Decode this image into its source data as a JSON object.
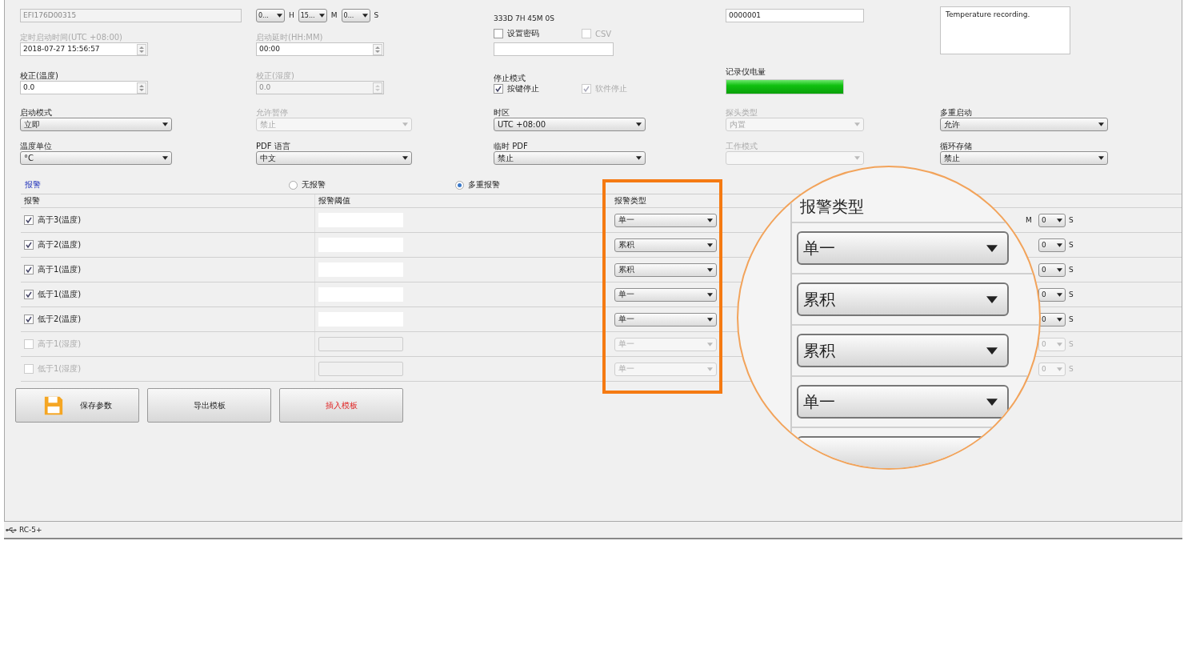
{
  "serial_field": {
    "value": "EFI176D00315"
  },
  "interval": [
    {
      "value": "0...",
      "unit": "H"
    },
    {
      "value": "15...",
      "unit": "M"
    },
    {
      "value": "0...",
      "unit": "S"
    }
  ],
  "duration": "333D 7H 45M 0S",
  "logger_number": {
    "value": "0000001"
  },
  "description": {
    "value": "Temperature recording."
  },
  "timed_start": {
    "label": "定时启动时间(UTC +08:00)",
    "value": "2018-07-27 15:56:57",
    "disabled": true
  },
  "start_delay": {
    "label": "启动延时(HH:MM)",
    "value": "00:00",
    "disabled": true
  },
  "options": [
    {
      "label": "设置密码",
      "checked": false,
      "disabled": false
    },
    {
      "label": "CSV",
      "checked": false,
      "disabled": true
    }
  ],
  "calibration": [
    {
      "label": "校正(温度)",
      "value": "0.0",
      "disabled": false
    },
    {
      "label": "校正(湿度)",
      "value": "0.0",
      "disabled": true
    }
  ],
  "stop_mode": {
    "label": "停止模式",
    "options": [
      {
        "label": "按键停止",
        "checked": true,
        "disabled": false
      },
      {
        "label": "软件停止",
        "checked": true,
        "disabled": true
      }
    ]
  },
  "battery": {
    "label": "记录仪电量",
    "level": 1.0
  },
  "select_rows": [
    [
      {
        "label": "启动模式",
        "value": "立即",
        "disabled": false
      },
      {
        "label": "允许暂停",
        "value": "禁止",
        "disabled": true
      },
      {
        "label": "时区",
        "value": "UTC +08:00",
        "disabled": false
      },
      {
        "label": "探头类型",
        "value": "内置",
        "disabled": true
      },
      {
        "label": "多重启动",
        "value": "允许",
        "disabled": false
      }
    ],
    [
      {
        "label": "温度单位",
        "value": "°C",
        "disabled": false
      },
      {
        "label": "PDF 语言",
        "value": "中文",
        "disabled": false
      },
      {
        "label": "临时 PDF",
        "value": "禁止",
        "disabled": false
      },
      {
        "label": "工作模式",
        "disabled": true
      },
      {
        "label": "循环存储",
        "value": "禁止",
        "disabled": false
      }
    ]
  ],
  "alarm": {
    "title": "报警",
    "modes": [
      {
        "label": "无报警",
        "selected": false
      },
      {
        "label": "多重报警",
        "selected": true
      }
    ],
    "columns": [
      "报警",
      "报警阈值",
      "报警类型"
    ],
    "rows": [
      {
        "label": "高于3(温度)",
        "checked": true,
        "disabled": false,
        "type": "单一",
        "m_unit": "M",
        "minutes": "0",
        "s_unit": "S"
      },
      {
        "label": "高于2(温度)",
        "checked": true,
        "disabled": false,
        "type": "累积",
        "minutes": "0",
        "s_unit": "S"
      },
      {
        "label": "高于1(温度)",
        "checked": true,
        "disabled": false,
        "type": "累积",
        "minutes": "0",
        "s_unit": "S"
      },
      {
        "label": "低于1(温度)",
        "checked": true,
        "disabled": false,
        "type": "单一",
        "minutes": "0",
        "s_unit": "S"
      },
      {
        "label": "低于2(温度)",
        "checked": true,
        "disabled": false,
        "type": "单一",
        "minutes": "0",
        "s_unit": "S"
      },
      {
        "label": "高于1(湿度)",
        "checked": false,
        "disabled": true,
        "type": "单一",
        "minutes": "0",
        "s_unit": "S"
      },
      {
        "label": "低于1(湿度)",
        "checked": false,
        "disabled": true,
        "type": "单一",
        "minutes": "0",
        "s_unit": "S"
      }
    ]
  },
  "buttons": [
    {
      "label": "保存参数",
      "kind": "save"
    },
    {
      "label": "导出模板",
      "kind": "plain"
    },
    {
      "label": "插入模板",
      "kind": "warning"
    }
  ],
  "magnifier": {
    "header": "报警类型",
    "types": [
      "单一",
      "累积",
      "累积",
      "单一"
    ]
  },
  "status_bar": {
    "device": "RC-5+"
  }
}
